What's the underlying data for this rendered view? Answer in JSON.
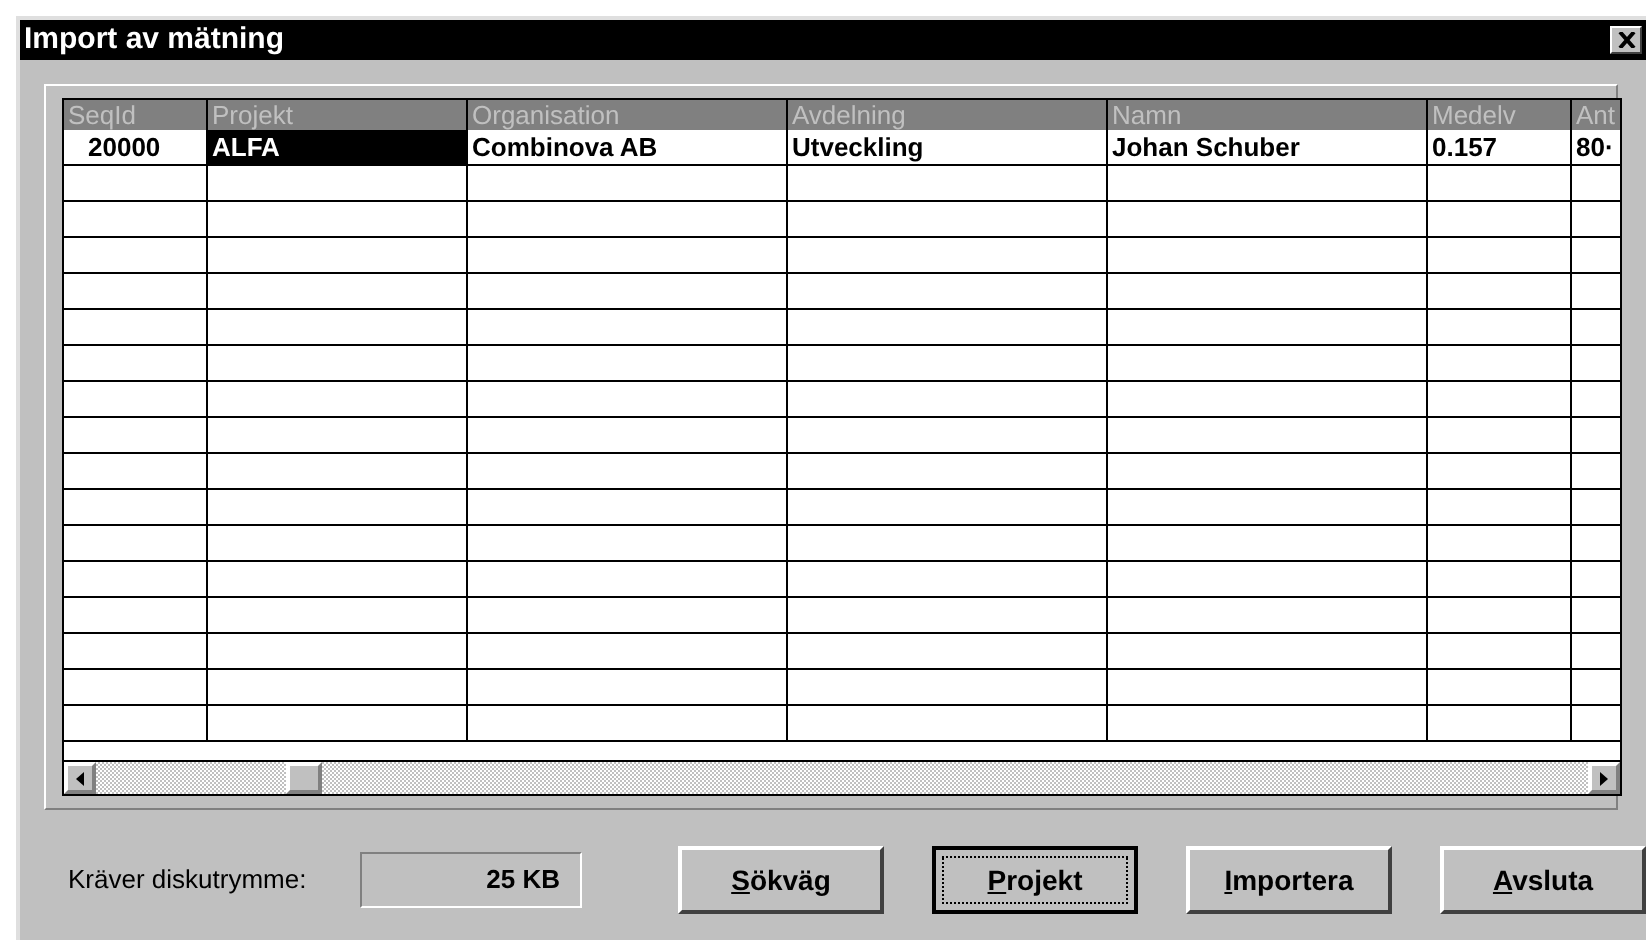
{
  "window": {
    "title": "Import av mätning"
  },
  "table": {
    "columns": [
      "SeqId",
      "Projekt",
      "Organisation",
      "Avdelning",
      "Namn",
      "Medelv",
      "Ant"
    ],
    "rows": [
      {
        "cells": [
          {
            "text": "20000",
            "selected": false
          },
          {
            "text": "ALFA",
            "selected": true
          },
          {
            "text": "Combinova AB",
            "selected": false
          },
          {
            "text": "Utveckling",
            "selected": false
          },
          {
            "text": "Johan Schuber",
            "selected": false
          },
          {
            "text": "0.157",
            "selected": false
          },
          {
            "text": "80·",
            "selected": false
          }
        ]
      }
    ]
  },
  "disk": {
    "label": "Kräver diskutrymme:",
    "value": "25  KB"
  },
  "buttons": [
    {
      "accel": "S",
      "rest": "ökväg",
      "focused": false
    },
    {
      "accel": "P",
      "rest": "rojekt",
      "focused": true
    },
    {
      "accel": "I",
      "rest": "mportera",
      "focused": false
    },
    {
      "accel": "A",
      "rest": "vsluta",
      "focused": false
    }
  ]
}
